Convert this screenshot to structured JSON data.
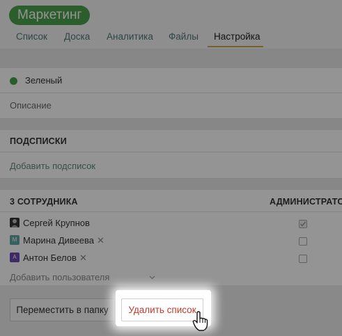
{
  "header": {
    "title": "Маркетинг",
    "tabs": [
      {
        "label": "Список"
      },
      {
        "label": "Доска"
      },
      {
        "label": "Аналитика"
      },
      {
        "label": "Файлы"
      },
      {
        "label": "Настройка",
        "active": true
      }
    ]
  },
  "settings": {
    "color_name": "Зеленый",
    "color_value": "#49a04c",
    "description_placeholder": "Описание"
  },
  "sublists": {
    "heading": "ПОДСПИСКИ",
    "add_link": "Добавить подсписок"
  },
  "members": {
    "heading": "3 СОТРУДНИКА",
    "admin_heading": "АДМИНИСТРАТОР",
    "list": [
      {
        "name": "Сергей Крупнов",
        "admin": true,
        "avatar_letter": "",
        "avatar_color": "#333333",
        "removable": false
      },
      {
        "name": "Марина Дивеева",
        "admin": false,
        "avatar_letter": "М",
        "avatar_color": "#5fa8a3",
        "removable": true
      },
      {
        "name": "Антон Белов",
        "admin": false,
        "avatar_letter": "А",
        "avatar_color": "#6b4bb0",
        "removable": true
      }
    ],
    "add_user_placeholder": "Добавить пользователя",
    "remove_glyph": "✕"
  },
  "actions": {
    "move_label": "Переместить в папку",
    "delete_label": "Удалить список"
  },
  "colors": {
    "accent_green": "#49a04c",
    "link": "#5f8a84",
    "danger": "#c0392b",
    "tab_underline": "#c8a74a"
  }
}
